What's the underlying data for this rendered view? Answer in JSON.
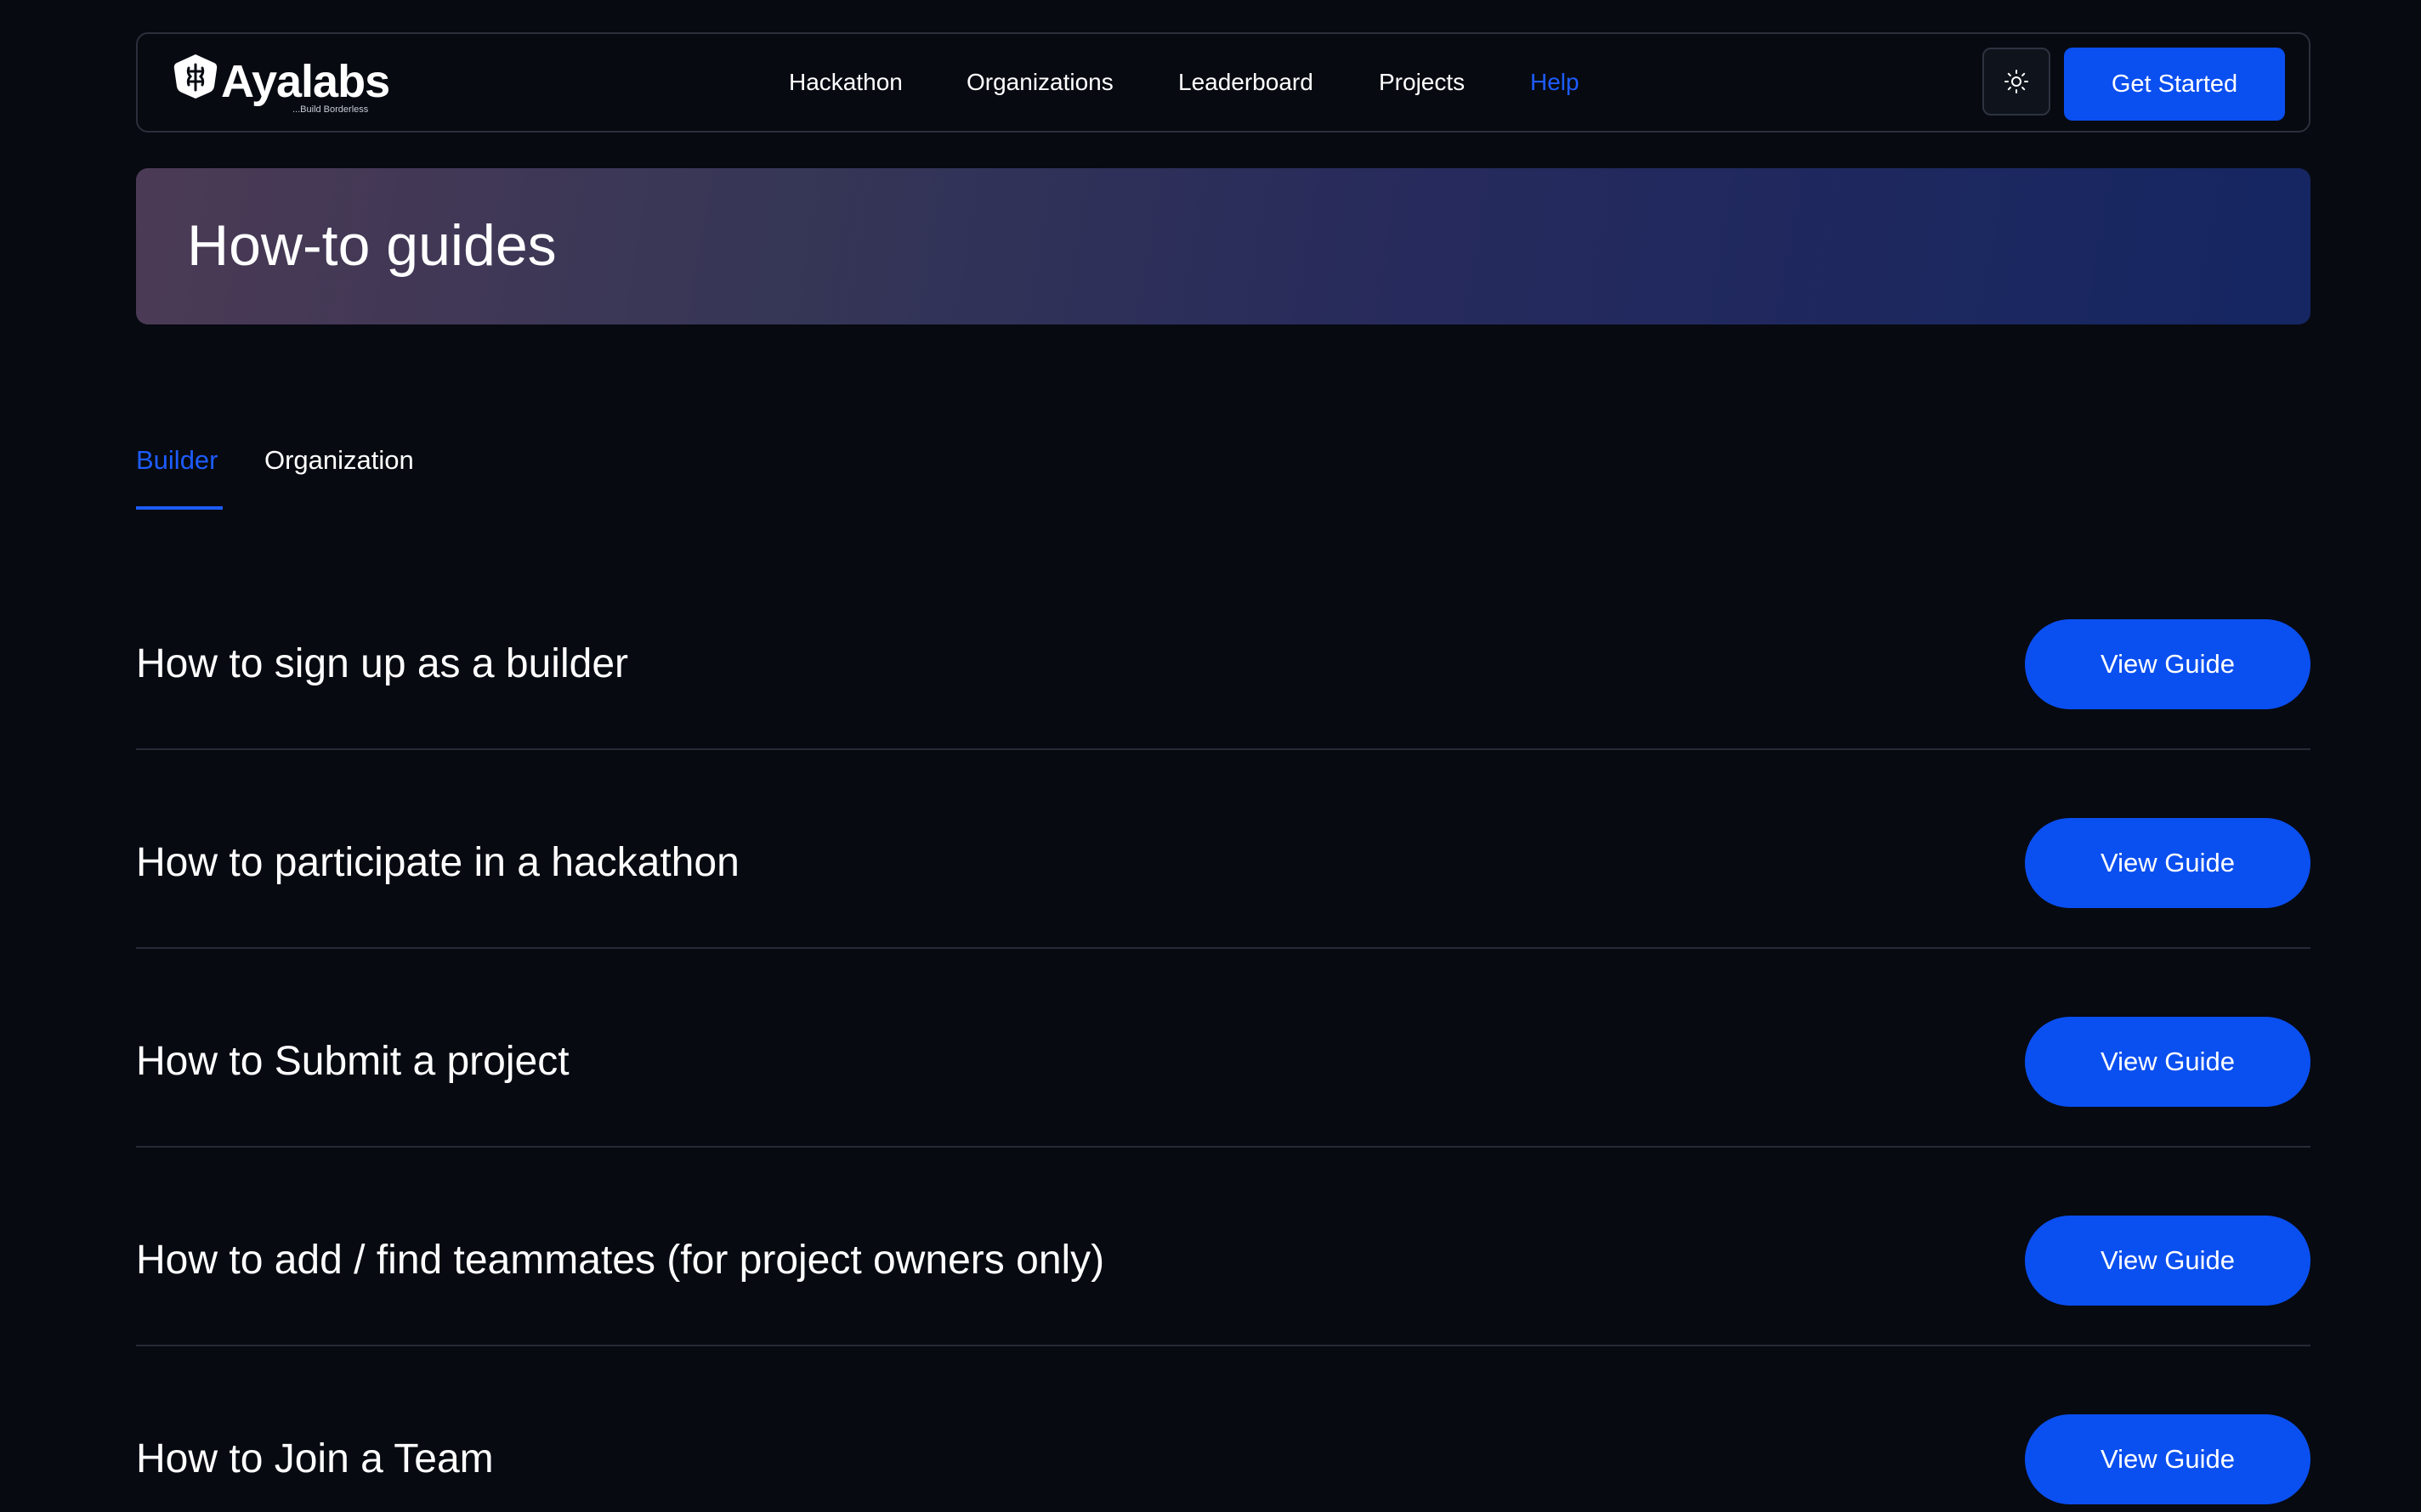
{
  "brand": {
    "name": "Ayalabs",
    "tagline": "...Build Borderless"
  },
  "nav": {
    "links": [
      {
        "label": "Hackathon"
      },
      {
        "label": "Organizations"
      },
      {
        "label": "Leaderboard"
      },
      {
        "label": "Projects"
      },
      {
        "label": "Help",
        "active": true
      }
    ],
    "theme_toggle_icon": "sun-icon",
    "cta_label": "Get Started"
  },
  "hero": {
    "title": "How-to guides"
  },
  "tabs": [
    {
      "label": "Builder",
      "active": true
    },
    {
      "label": "Organization",
      "active": false
    }
  ],
  "guides": [
    {
      "title": "How to sign up as a builder",
      "button": "View Guide"
    },
    {
      "title": "How to participate in a hackathon",
      "button": "View Guide"
    },
    {
      "title": "How to Submit a project",
      "button": "View Guide"
    },
    {
      "title": "How to add / find teammates (for project owners only)",
      "button": "View Guide"
    },
    {
      "title": "How to Join a Team",
      "button": "View Guide"
    }
  ],
  "colors": {
    "background": "#070a11",
    "accent": "#0a4ff0",
    "active_link": "#1d5cff"
  }
}
